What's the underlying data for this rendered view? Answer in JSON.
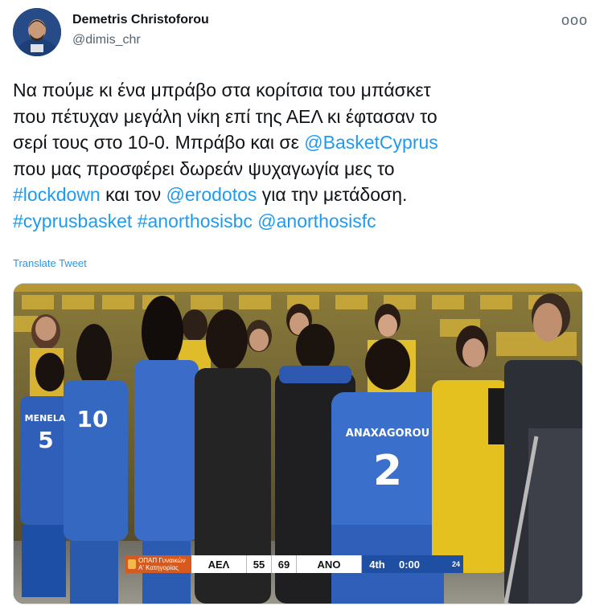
{
  "author": {
    "name": "Demetris Christoforou",
    "handle": "@dimis_chr"
  },
  "more_label": "ooo",
  "tweet": {
    "line1": "Να πούμε κι ένα μπράβο στα κορίτσια του μπάσκετ",
    "line2": "που πέτυχαν μεγάλη νίκη επί της ΑΕΛ κι έφτασαν το",
    "line3_text": "σερί τους στο 10-0. Μπράβο και σε ",
    "line3_mention": "@BasketCyprus",
    "line4": "που μας προσφέρει δωρεάν ψυχαγωγία μες το",
    "line5_hashtag": "#lockdown",
    "line5_mid": " και τον ",
    "line5_mention": "@erodotos",
    "line5_end": " για την μετάδοση.",
    "line6_hashtag1": "#cyprusbasket",
    "line6_hashtag2": "#anorthosisbc",
    "line6_mention": "@anorthosisfc"
  },
  "translate_label": "Translate Tweet",
  "media": {
    "jerseys": [
      "MENELA",
      "5",
      "ANAXAGOROU",
      "2",
      "10"
    ],
    "scoreboard": {
      "league_line1": "ΟΠΑΠ Γυναικών",
      "league_line2": "Α' Κατηγορίας",
      "home_team": "ΑΕΛ",
      "home_score": "55",
      "away_score": "69",
      "away_team": "ΑΝΟ",
      "period": "4th",
      "clock": "0:00",
      "shot_clock": "24"
    }
  },
  "colors": {
    "link": "#1d9bf0",
    "handle": "#536471",
    "home_blue": "#2f5fb8",
    "away_yellow": "#e7c21c",
    "scoreboard_orange": "#d65a1e",
    "scoreboard_blue": "#1e4fa3"
  }
}
